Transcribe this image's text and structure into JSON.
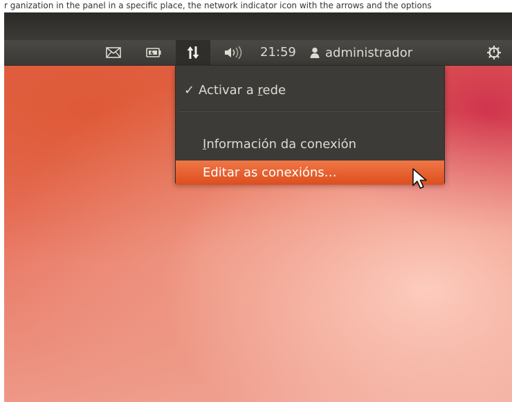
{
  "top_caption": "r ganization in the panel in a specific place, the network indicator icon with the arrows and the options",
  "panel": {
    "indicators": [
      {
        "name": "mail-icon"
      },
      {
        "name": "battery-icon"
      },
      {
        "name": "network-arrows-icon"
      },
      {
        "name": "speaker-icon"
      }
    ],
    "clock": "21:59",
    "user_name": "administrador",
    "session_icon": "gear-power-icon"
  },
  "menu": {
    "activate": {
      "checked": true,
      "check_glyph": "✓",
      "label_before": "Activar a ",
      "mnemonic": "r",
      "label_after": "ede"
    },
    "info": {
      "mnemonic": "I",
      "label_after": "nformación da conexión"
    },
    "edit": {
      "label": "Editar as conexións…",
      "highlighted": true
    }
  },
  "colors": {
    "panel": "#3c3b37",
    "panel_text": "#dfdbd2",
    "highlight": "#e9642f",
    "wallpaper": "#e16a4e"
  }
}
